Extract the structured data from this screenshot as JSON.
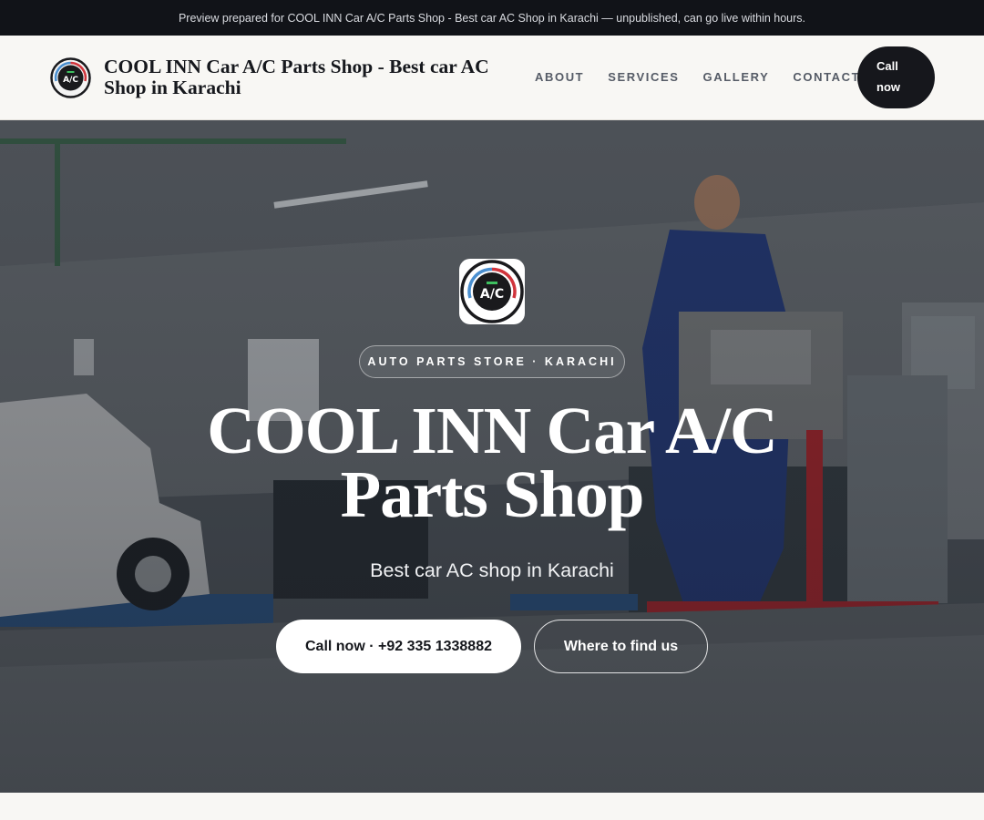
{
  "preview_banner": "Preview prepared for COOL INN Car A/C Parts Shop - Best car AC Shop in Karachi — unpublished, can go live within hours.",
  "header": {
    "brand_name": "COOL INN Car A/C Parts Shop - Best car AC Shop in Karachi",
    "logo_text": "A/C",
    "nav": [
      {
        "label": "ABOUT"
      },
      {
        "label": "SERVICES"
      },
      {
        "label": "GALLERY"
      },
      {
        "label": "CONTACT"
      }
    ],
    "call_label": "Call now"
  },
  "hero": {
    "logo_text": "A/C",
    "eyebrow": "AUTO PARTS STORE · KARACHI",
    "title": "COOL INN Car A/C Parts Shop",
    "subtitle": "Best car AC shop in Karachi",
    "primary_button": "Call now · +92 335 1338882",
    "secondary_button": "Where to find us"
  },
  "colors": {
    "dark": "#16171c",
    "logo_blue": "#4a8fd0",
    "logo_red": "#d0343c",
    "logo_green": "#3ec060"
  }
}
